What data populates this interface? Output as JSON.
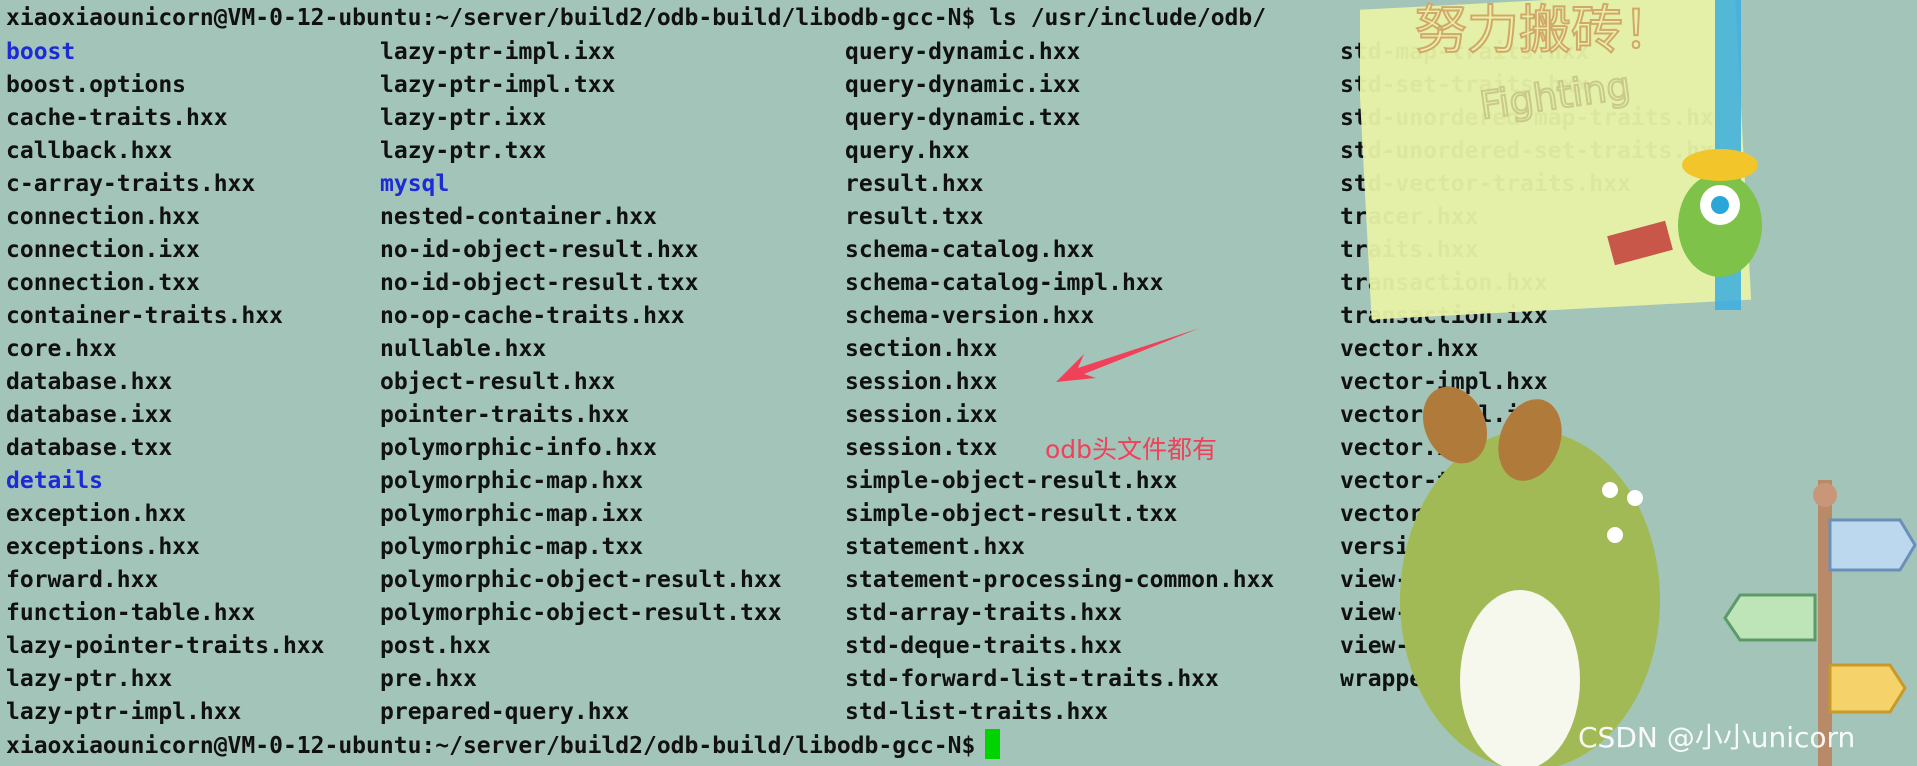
{
  "terminal": {
    "prompt_ls": "xiaoxiaounicorn@VM-0-12-ubuntu:~/server/build2/odb-build/libodb-gcc-N$ ls /usr/include/odb/",
    "prompt_end": "xiaoxiaounicorn@VM-0-12-ubuntu:~/server/build2/odb-build/libodb-gcc-N$",
    "dir_color": "#1c2bd6",
    "cursor_color": "#00d400",
    "columns": [
      [
        {
          "name": "boost",
          "dir": true
        },
        {
          "name": "boost.options"
        },
        {
          "name": "cache-traits.hxx"
        },
        {
          "name": "callback.hxx"
        },
        {
          "name": "c-array-traits.hxx"
        },
        {
          "name": "connection.hxx"
        },
        {
          "name": "connection.ixx"
        },
        {
          "name": "connection.txx"
        },
        {
          "name": "container-traits.hxx"
        },
        {
          "name": "core.hxx"
        },
        {
          "name": "database.hxx"
        },
        {
          "name": "database.ixx"
        },
        {
          "name": "database.txx"
        },
        {
          "name": "details",
          "dir": true
        },
        {
          "name": "exception.hxx"
        },
        {
          "name": "exceptions.hxx"
        },
        {
          "name": "forward.hxx"
        },
        {
          "name": "function-table.hxx"
        },
        {
          "name": "lazy-pointer-traits.hxx"
        },
        {
          "name": "lazy-ptr.hxx"
        },
        {
          "name": "lazy-ptr-impl.hxx"
        }
      ],
      [
        {
          "name": "lazy-ptr-impl.ixx"
        },
        {
          "name": "lazy-ptr-impl.txx"
        },
        {
          "name": "lazy-ptr.ixx"
        },
        {
          "name": "lazy-ptr.txx"
        },
        {
          "name": "mysql",
          "dir": true
        },
        {
          "name": "nested-container.hxx"
        },
        {
          "name": "no-id-object-result.hxx"
        },
        {
          "name": "no-id-object-result.txx"
        },
        {
          "name": "no-op-cache-traits.hxx"
        },
        {
          "name": "nullable.hxx"
        },
        {
          "name": "object-result.hxx"
        },
        {
          "name": "pointer-traits.hxx"
        },
        {
          "name": "polymorphic-info.hxx"
        },
        {
          "name": "polymorphic-map.hxx"
        },
        {
          "name": "polymorphic-map.ixx"
        },
        {
          "name": "polymorphic-map.txx"
        },
        {
          "name": "polymorphic-object-result.hxx"
        },
        {
          "name": "polymorphic-object-result.txx"
        },
        {
          "name": "post.hxx"
        },
        {
          "name": "pre.hxx"
        },
        {
          "name": "prepared-query.hxx"
        }
      ],
      [
        {
          "name": "query-dynamic.hxx"
        },
        {
          "name": "query-dynamic.ixx"
        },
        {
          "name": "query-dynamic.txx"
        },
        {
          "name": "query.hxx"
        },
        {
          "name": "result.hxx"
        },
        {
          "name": "result.txx"
        },
        {
          "name": "schema-catalog.hxx"
        },
        {
          "name": "schema-catalog-impl.hxx"
        },
        {
          "name": "schema-version.hxx"
        },
        {
          "name": "section.hxx"
        },
        {
          "name": "session.hxx"
        },
        {
          "name": "session.ixx"
        },
        {
          "name": "session.txx"
        },
        {
          "name": "simple-object-result.hxx"
        },
        {
          "name": "simple-object-result.txx"
        },
        {
          "name": "statement.hxx"
        },
        {
          "name": "statement-processing-common.hxx"
        },
        {
          "name": "std-array-traits.hxx"
        },
        {
          "name": "std-deque-traits.hxx"
        },
        {
          "name": "std-forward-list-traits.hxx"
        },
        {
          "name": "std-list-traits.hxx"
        }
      ],
      [
        {
          "name": "std-map-traits.hxx"
        },
        {
          "name": "std-set-traits.hxx"
        },
        {
          "name": "std-unordered-map-traits.hxx"
        },
        {
          "name": "std-unordered-set-traits.hxx"
        },
        {
          "name": "std-vector-traits.hxx"
        },
        {
          "name": "tracer.hxx"
        },
        {
          "name": "traits.hxx"
        },
        {
          "name": "transaction.hxx"
        },
        {
          "name": "transaction.ixx"
        },
        {
          "name": "vector.hxx"
        },
        {
          "name": "vector-impl.hxx"
        },
        {
          "name": "vector-impl.ixx"
        },
        {
          "name": "vector.ixx"
        },
        {
          "name": "vector-traits.hxx"
        },
        {
          "name": "vector-traits.txx"
        },
        {
          "name": "version.hxx"
        },
        {
          "name": "view-image.hxx"
        },
        {
          "name": "view-result.hxx"
        },
        {
          "name": "view-result.txx"
        },
        {
          "name": "wrapper-traits.hxx"
        }
      ]
    ]
  },
  "annotation": {
    "text": "odb头文件都有",
    "color": "#f0405a"
  },
  "decoration": {
    "sticker_text": "努力搬砖！",
    "sticker_sub": "Fighting"
  },
  "watermark": {
    "text": "CSDN @小小unicorn"
  }
}
